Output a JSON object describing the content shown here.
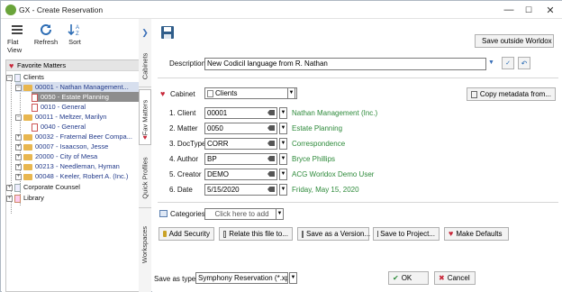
{
  "window": {
    "title": "GX - Create Reservation",
    "minimize": "—",
    "maximize": "☐",
    "close": "✕"
  },
  "toolbar": {
    "flat_view": "Flat View",
    "refresh": "Refresh",
    "sort": "Sort"
  },
  "tree": {
    "header": "Favorite Matters",
    "items": [
      {
        "label": "Clients"
      },
      {
        "label": "00001 - Nathan Management..."
      },
      {
        "label": "0050 - Estate Planning"
      },
      {
        "label": "0010 - General"
      },
      {
        "label": "00011 - Meltzer, Marilyn"
      },
      {
        "label": "0040 - General"
      },
      {
        "label": "00032 - Fraternal Beer Compa..."
      },
      {
        "label": "00007 - Isaacson, Jesse"
      },
      {
        "label": "20000 - City of Mesa"
      },
      {
        "label": "00213 - Needleman, Hyman"
      },
      {
        "label": "00048 - Keeler, Robert A. (Inc.)"
      },
      {
        "label": "Corporate Counsel"
      },
      {
        "label": "Library"
      }
    ]
  },
  "side_tabs": [
    "Cabinets",
    "Fav Matters",
    "Quick Profiles",
    "Workspaces"
  ],
  "form": {
    "save_outside": "Save outside Worldox",
    "description_label": "Description",
    "description_value": "New Codicil language from R. Nathan",
    "cabinet_label": "Cabinet",
    "cabinet_value": "Clients",
    "copy_metadata": "Copy metadata from...",
    "fields": [
      {
        "label": "1. Client",
        "value": "00001",
        "desc": "Nathan Management (Inc.)"
      },
      {
        "label": "2. Matter",
        "value": "0050",
        "desc": "Estate Planning"
      },
      {
        "label": "3. DocType",
        "value": "CORR",
        "desc": "Correspondence"
      },
      {
        "label": "4. Author",
        "value": "BP",
        "desc": "Bryce Phillips"
      },
      {
        "label": "5. Creator",
        "value": "DEMO",
        "desc": "ACG Worldox Demo User"
      },
      {
        "label": "6. Date",
        "value": "5/15/2020",
        "desc": "Friday, May 15, 2020"
      }
    ],
    "categories_label": "Categories",
    "categories_placeholder": "Click here to add",
    "actions": {
      "add_security": "Add Security",
      "relate": "Relate this file to...",
      "save_version": "Save as a Version...",
      "save_project": "Save to Project...",
      "make_defaults": "Make Defaults"
    },
    "save_as_type_label": "Save as type:",
    "save_as_type_value": "Symphony Reservation (*.xpf)",
    "ok": "OK",
    "cancel": "Cancel"
  },
  "colors": {
    "accent_green": "#2d8a3a",
    "link_blue": "#223a8a",
    "selection": "#8d8d8d",
    "favorite_red": "#c8283a"
  }
}
